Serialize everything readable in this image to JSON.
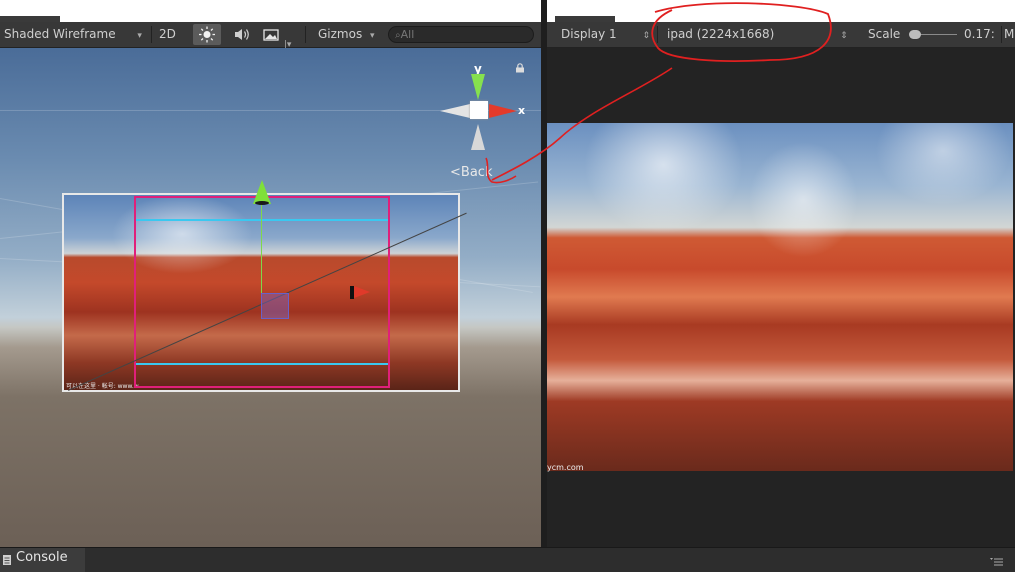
{
  "scene_toolbar": {
    "shading_mode": "Shaded Wireframe",
    "mode_2d": "2D",
    "lighting_icon": "sun-icon",
    "audio_icon": "speaker-icon",
    "effects_icon": "image-icon",
    "gizmos": "Gizmos",
    "search_placeholder": "All"
  },
  "scene_gizmo": {
    "y_label": "y",
    "x_label": "x",
    "view_label": "Back",
    "lock_icon": "lock-icon"
  },
  "scene_overlay": {
    "photo_caption": "可以在这里 · 帐号: www.w..."
  },
  "game_toolbar": {
    "display": "Display 1",
    "resolution": "ipad (2224x1668)",
    "scale_label": "Scale",
    "scale_value": "0.17:",
    "maximize_initial": "M"
  },
  "game_view": {
    "caption": "ycm.com"
  },
  "console": {
    "label": "Console",
    "menu_icon": "menu-icon"
  },
  "annotation_color": "#e02020",
  "colors": {
    "toolbar_bg": "#383838",
    "magenta_frame": "#e0207a",
    "cyan_line": "#3ac8f0",
    "y_axis": "#86e14e",
    "x_axis": "#e43a2a"
  }
}
